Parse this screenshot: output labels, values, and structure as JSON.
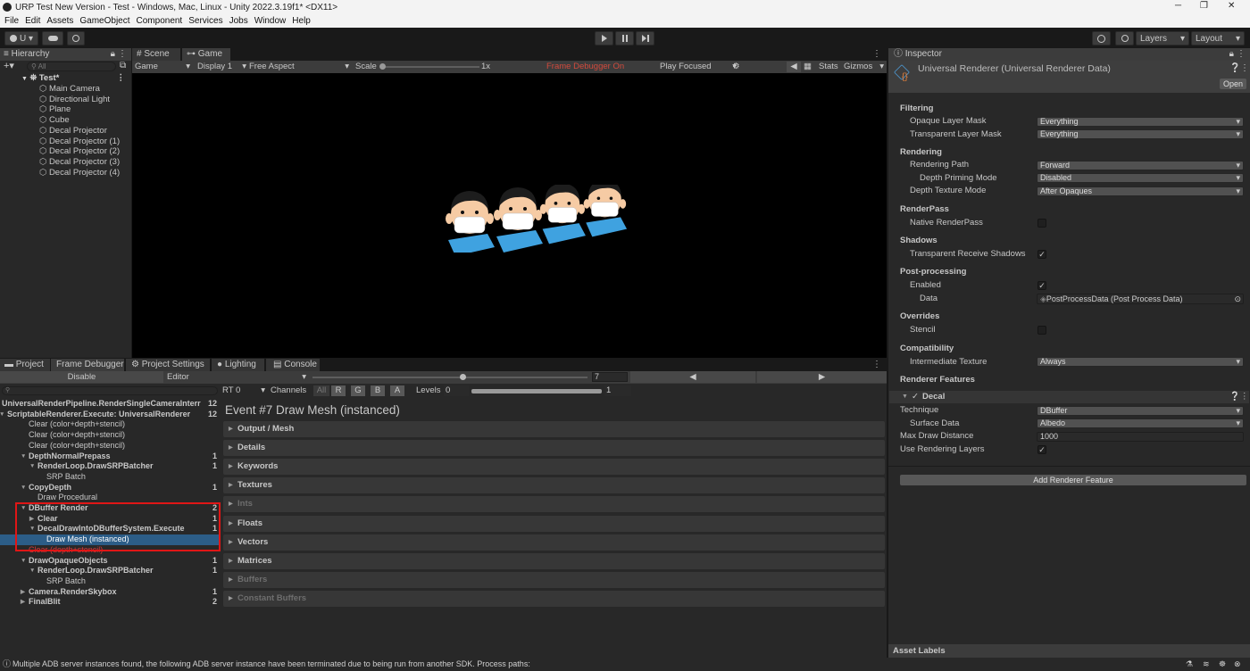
{
  "window": {
    "title": "URP Test New Version - Test - Windows, Mac, Linux - Unity 2022.3.19f1* <DX11>",
    "minimize": "─",
    "maximize": "❐",
    "close": "✕"
  },
  "menu": [
    "File",
    "Edit",
    "Assets",
    "GameObject",
    "Component",
    "Services",
    "Jobs",
    "Window",
    "Help"
  ],
  "toolbar": {
    "account": "U ▾",
    "layers": "Layers",
    "layout": "Layout"
  },
  "hierarchy": {
    "tab": "Hierarchy",
    "search_placeholder": "All",
    "scene": "Test*",
    "items": [
      "Main Camera",
      "Directional Light",
      "Plane",
      "Cube",
      "Decal Projector",
      "Decal Projector (1)",
      "Decal Projector (2)",
      "Decal Projector (3)",
      "Decal Projector (4)"
    ]
  },
  "game": {
    "tab_scene": "Scene",
    "tab_game": "Game",
    "mode": "Game",
    "display": "Display 1",
    "aspect": "Free Aspect",
    "scale_label": "Scale",
    "scale_value": "1x",
    "frame_debugger_on": "Frame Debugger On",
    "play_focused": "Play Focused",
    "stats": "Stats",
    "gizmos": "Gizmos"
  },
  "bottom_tabs": [
    "Project",
    "Frame Debugger",
    "Project Settings",
    "Lighting",
    "Console"
  ],
  "frame_debugger": {
    "disable": "Disable",
    "editor": "Editor",
    "event_index": "7",
    "rt": "RT 0",
    "channels_label": "Channels",
    "channels": [
      "All",
      "R",
      "G",
      "B",
      "A"
    ],
    "levels_label": "Levels",
    "levels_min": "0",
    "levels_max": "1",
    "event_title": "Event #7 Draw Mesh (instanced)",
    "tree": [
      {
        "label": "UniversalRenderPipeline.RenderSingleCameraInterr",
        "count": "12",
        "indent": 0,
        "bold": true,
        "arrow": "▼"
      },
      {
        "label": "ScriptableRenderer.Execute: UniversalRenderer",
        "count": "12",
        "indent": 1,
        "bold": true,
        "arrow": "▼"
      },
      {
        "label": "Clear (color+depth+stencil)",
        "count": "",
        "indent": 2,
        "bold": false,
        "arrow": ""
      },
      {
        "label": "Clear (color+depth+stencil)",
        "count": "",
        "indent": 2,
        "bold": false,
        "arrow": ""
      },
      {
        "label": "Clear (color+depth+stencil)",
        "count": "",
        "indent": 2,
        "bold": false,
        "arrow": ""
      },
      {
        "label": "DepthNormalPrepass",
        "count": "1",
        "indent": 2,
        "bold": true,
        "arrow": "▼"
      },
      {
        "label": "RenderLoop.DrawSRPBatcher",
        "count": "1",
        "indent": 3,
        "bold": true,
        "arrow": "▼"
      },
      {
        "label": "SRP Batch",
        "count": "",
        "indent": 4,
        "bold": false,
        "arrow": ""
      },
      {
        "label": "CopyDepth",
        "count": "1",
        "indent": 2,
        "bold": true,
        "arrow": "▼"
      },
      {
        "label": "Draw Procedural",
        "count": "",
        "indent": 3,
        "bold": false,
        "arrow": ""
      },
      {
        "label": "DBuffer Render",
        "count": "2",
        "indent": 2,
        "bold": true,
        "arrow": "▼"
      },
      {
        "label": "Clear",
        "count": "1",
        "indent": 3,
        "bold": true,
        "arrow": "▶"
      },
      {
        "label": "DecalDrawIntoDBufferSystem.Execute",
        "count": "1",
        "indent": 3,
        "bold": true,
        "arrow": "▼"
      },
      {
        "label": "Draw Mesh (instanced)",
        "count": "",
        "indent": 4,
        "bold": false,
        "arrow": "",
        "selected": true
      },
      {
        "label": "Clear (depth+stencil)",
        "count": "",
        "indent": 2,
        "bold": false,
        "arrow": "",
        "red": true
      },
      {
        "label": "DrawOpaqueObjects",
        "count": "1",
        "indent": 2,
        "bold": true,
        "arrow": "▼"
      },
      {
        "label": "RenderLoop.DrawSRPBatcher",
        "count": "1",
        "indent": 3,
        "bold": true,
        "arrow": "▼"
      },
      {
        "label": "SRP Batch",
        "count": "",
        "indent": 4,
        "bold": false,
        "arrow": ""
      },
      {
        "label": "Camera.RenderSkybox",
        "count": "1",
        "indent": 2,
        "bold": true,
        "arrow": "▶"
      },
      {
        "label": "FinalBlit",
        "count": "2",
        "indent": 2,
        "bold": true,
        "arrow": "▶"
      }
    ],
    "foldouts": [
      {
        "label": "Output / Mesh",
        "dim": false
      },
      {
        "label": "Details",
        "dim": false
      },
      {
        "label": "Keywords",
        "dim": false
      },
      {
        "label": "Textures",
        "dim": false
      },
      {
        "label": "Ints",
        "dim": true
      },
      {
        "label": "Floats",
        "dim": false
      },
      {
        "label": "Vectors",
        "dim": false
      },
      {
        "label": "Matrices",
        "dim": false
      },
      {
        "label": "Buffers",
        "dim": true
      },
      {
        "label": "Constant Buffers",
        "dim": true
      }
    ]
  },
  "inspector": {
    "tab": "Inspector",
    "asset_title": "Universal Renderer (Universal Renderer Data)",
    "open": "Open",
    "sections": {
      "filtering": "Filtering",
      "rendering": "Rendering",
      "renderpass": "RenderPass",
      "shadows": "Shadows",
      "postprocessing": "Post-processing",
      "overrides": "Overrides",
      "compatibility": "Compatibility",
      "renderer_features": "Renderer Features"
    },
    "fields": {
      "opaque_mask_label": "Opaque Layer Mask",
      "opaque_mask": "Everything",
      "transparent_mask_label": "Transparent Layer Mask",
      "transparent_mask": "Everything",
      "rendering_path_label": "Rendering Path",
      "rendering_path": "Forward",
      "depth_priming_label": "Depth Priming Mode",
      "depth_priming": "Disabled",
      "depth_texture_label": "Depth Texture Mode",
      "depth_texture": "After Opaques",
      "native_renderpass_label": "Native RenderPass",
      "transparent_shadows_label": "Transparent Receive Shadows",
      "pp_enabled_label": "Enabled",
      "pp_data_label": "Data",
      "pp_data": "PostProcessData (Post Process Data)",
      "stencil_label": "Stencil",
      "intermediate_label": "Intermediate Texture",
      "intermediate": "Always"
    },
    "decal": {
      "name": "Decal",
      "technique_label": "Technique",
      "technique": "DBuffer",
      "surface_label": "Surface Data",
      "surface": "Albedo",
      "max_draw_label": "Max Draw Distance",
      "max_draw": "1000",
      "rendering_layers_label": "Use Rendering Layers"
    },
    "add_feature": "Add Renderer Feature",
    "asset_labels": "Asset Labels"
  },
  "status": {
    "message": "Multiple ADB server instances found, the following ADB server instance have been terminated due to being run from another SDK. Process paths:"
  }
}
